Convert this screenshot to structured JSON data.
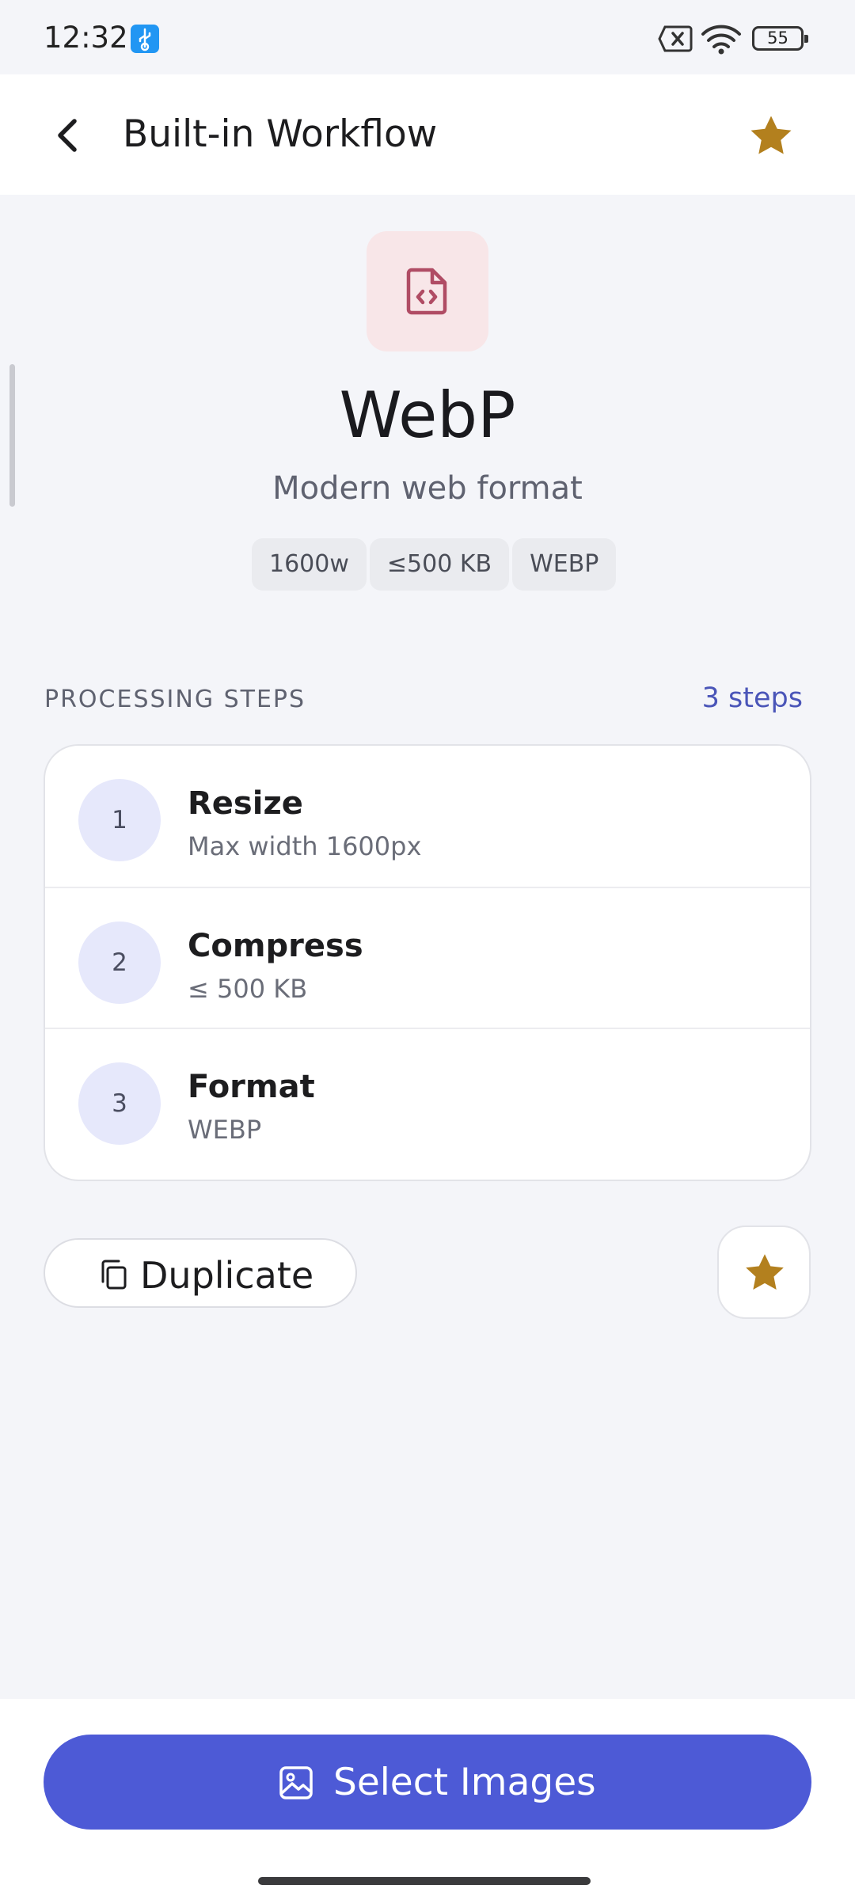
{
  "status_bar": {
    "time": "12:32",
    "battery": "55",
    "icons": [
      "usb-debug-icon",
      "sim-none-icon",
      "wifi-icon",
      "battery-icon"
    ]
  },
  "app_bar": {
    "title": "Built-in Workflow",
    "back_icon": "arrow-left-icon",
    "favorite_icon": "star-icon"
  },
  "workflow": {
    "icon": "file-code-icon",
    "name": "WebP",
    "description": "Modern web format",
    "chips": [
      "1600w",
      "≤500 KB",
      "WEBP"
    ]
  },
  "steps_section": {
    "label": "PROCESSING STEPS",
    "count": "3 steps",
    "steps": [
      {
        "number": "1",
        "title": "Resize",
        "detail": "Max width 1600px"
      },
      {
        "number": "2",
        "title": "Compress",
        "detail": "≤ 500 KB"
      },
      {
        "number": "3",
        "title": "Format",
        "detail": "WEBP"
      }
    ]
  },
  "actions": {
    "duplicate_label": "Duplicate",
    "duplicate_icon": "copy-icon",
    "favorite_icon": "star-icon"
  },
  "bottom": {
    "select_label": "Select Images",
    "select_icon": "image-icon"
  },
  "colors": {
    "accent": "#4d5ad6",
    "star": "#b3801e",
    "icon_tile": "#f8e6e8",
    "icon_tint": "#b04c64",
    "step_circle": "#e6e8fb"
  }
}
